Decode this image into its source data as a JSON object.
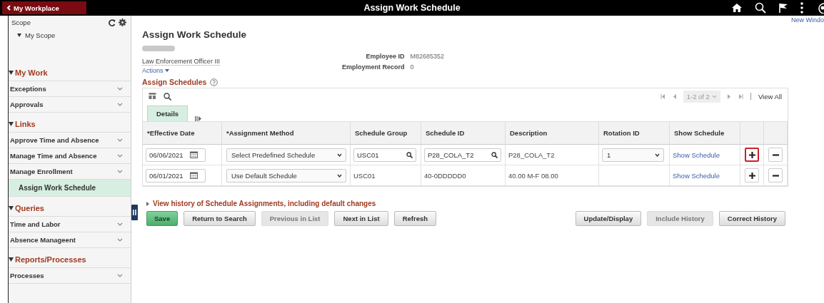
{
  "top_bar": {
    "back_button": "My Workplace",
    "title": "Assign Work Schedule",
    "new_window": "New Windo"
  },
  "sidebar": {
    "scope_label": "Scope",
    "scope_item": "My Scope",
    "sections": [
      {
        "title": "My Work",
        "expanded": true,
        "items": [
          {
            "label": "Exceptions",
            "selected": false
          },
          {
            "label": "Approvals",
            "selected": false
          }
        ]
      },
      {
        "title": "Links",
        "expanded": true,
        "items": [
          {
            "label": "Approve Time and Absence",
            "selected": false
          },
          {
            "label": "Manage Time and Absence",
            "selected": false
          },
          {
            "label": "Manage Enrollment",
            "selected": false,
            "children": [
              {
                "label": "Assign Work Schedule",
                "selected": true
              }
            ]
          }
        ]
      },
      {
        "title": "Queries",
        "expanded": true,
        "items": [
          {
            "label": "Time and Labor",
            "selected": false
          },
          {
            "label": "Absence Manageent",
            "selected": false
          }
        ]
      },
      {
        "title": "Reports/Processes",
        "expanded": true,
        "items": [
          {
            "label": "Processes",
            "selected": false
          }
        ]
      }
    ]
  },
  "main": {
    "title": "Assign Work Schedule",
    "job_title": "Law Enforcement Officer III",
    "actions": "Actions",
    "fields": [
      {
        "label": "Employee ID",
        "value": "M82685352"
      },
      {
        "label": "Employment Record",
        "value": "0"
      }
    ],
    "section_title": "Assign Schedules",
    "grid": {
      "pager": "1-2 of 2",
      "view_all": "View All",
      "tabs": [
        {
          "label": "Details",
          "selected": true
        }
      ],
      "columns": [
        "*Effective Date",
        "*Assignment Method",
        "Schedule Group",
        "Schedule ID",
        "Description",
        "Rotation ID",
        "Show Schedule"
      ],
      "rows": [
        {
          "effective_date": "06/06/2021",
          "assignment_method": "Select Predefined Schedule",
          "schedule_group": {
            "value": "USC01",
            "kind": "lookup"
          },
          "schedule_id": {
            "value": "P28_COLA_T2",
            "kind": "lookup"
          },
          "description": "P28_COLA_T2",
          "rotation_id": "1",
          "show_schedule": "Show Schedule",
          "add_highlighted": true
        },
        {
          "effective_date": "06/01/2021",
          "assignment_method": "Use Default Schedule",
          "schedule_group": {
            "value": "USC01",
            "kind": "text"
          },
          "schedule_id": {
            "value": "40-0DDDDD0",
            "kind": "text"
          },
          "description": "40.00 M-F 08.00",
          "show_schedule": "Show Schedule",
          "add_highlighted": false
        }
      ]
    },
    "history_link": "View history of Schedule Assignments, including default changes",
    "buttons_left": [
      {
        "label": "Save",
        "kind": "primary",
        "disabled": false
      },
      {
        "label": "Return to Search",
        "kind": "normal",
        "disabled": false
      },
      {
        "label": "Previous in List",
        "kind": "normal",
        "disabled": true
      },
      {
        "label": "Next in List",
        "kind": "normal",
        "disabled": false
      },
      {
        "label": "Refresh",
        "kind": "normal",
        "disabled": false
      }
    ],
    "buttons_right": [
      {
        "label": "Update/Display",
        "disabled": false
      },
      {
        "label": "Include History",
        "disabled": true
      },
      {
        "label": "Correct History",
        "disabled": false
      }
    ]
  }
}
